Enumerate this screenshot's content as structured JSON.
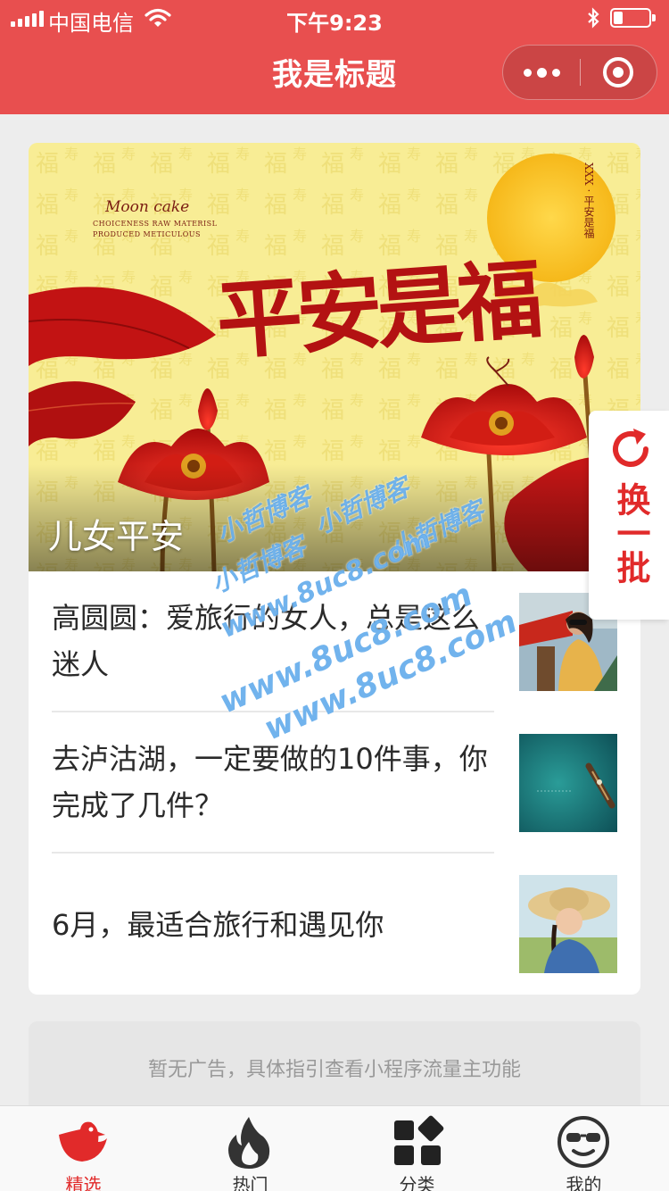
{
  "status_bar": {
    "carrier": "中国电信",
    "time": "下午9:23"
  },
  "nav": {
    "title": "我是标题",
    "more_icon": "more-dots-icon",
    "close_icon": "target-circle-icon"
  },
  "banner": {
    "caption": "儿女平安",
    "brand": "Moon cake",
    "brand_line1": "CHOICENESS RAW MATERISL",
    "brand_line2": "PRODUCED METICULOUS",
    "calligraphy": "平安是福",
    "moon_text": "XXX · 平安是福"
  },
  "articles": [
    {
      "title": "高圆圆：爱旅行的女人，总是这么迷人",
      "thumb": "woman-with-sunglasses-image"
    },
    {
      "title": "去泸沽湖，一定要做的10件事，你完成了几件？",
      "thumb": "boat-on-lake-image"
    },
    {
      "title": "6月，最适合旅行和遇见你",
      "thumb": "woman-in-straw-hat-image"
    }
  ],
  "refresh_button": {
    "label": "换一批",
    "icon": "refresh-icon"
  },
  "watermark": {
    "text1": "小哲博客",
    "text2": "小哲博客",
    "text3": "小哲博客",
    "text4": "小哲博客",
    "url1": "www.8uc8.com",
    "url2": "www.8uc8.com",
    "url3": "www.8uc8.com"
  },
  "ad": {
    "text": "暂无广告，具体指引查看小程序流量主功能"
  },
  "tabs": [
    {
      "label": "精选",
      "icon": "bird-icon",
      "active": true
    },
    {
      "label": "热门",
      "icon": "flame-icon",
      "active": false
    },
    {
      "label": "分类",
      "icon": "grid-icon",
      "active": false
    },
    {
      "label": "我的",
      "icon": "sunglasses-face-icon",
      "active": false
    }
  ],
  "colors": {
    "accent": "#e84f4f",
    "tab_active": "#e12a2a",
    "card_bg": "#ffffff",
    "page_bg": "#ededed"
  }
}
